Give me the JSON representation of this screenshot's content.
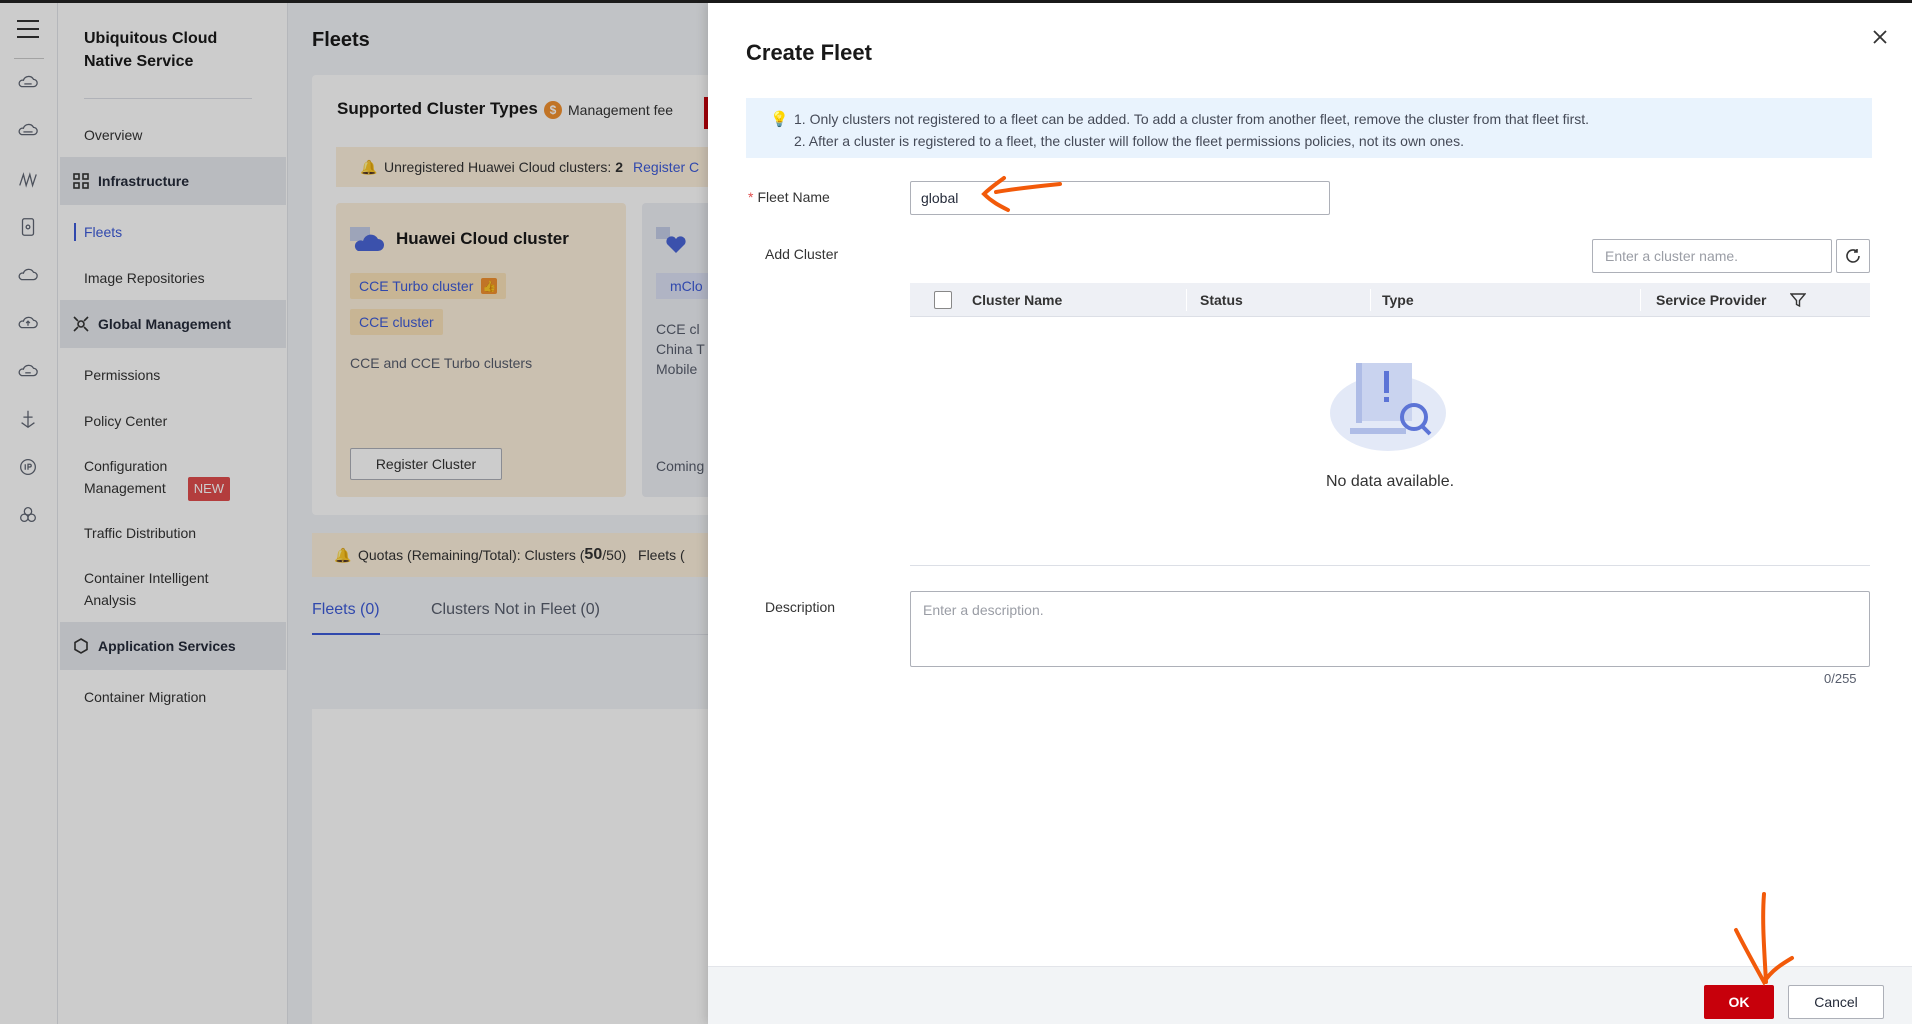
{
  "app": {
    "service_title": "Ubiquitous Cloud Native Service",
    "rail_icons": [
      "cloud-icon",
      "cloud-server-icon",
      "pipeline-icon",
      "container-icon",
      "cloud-outline-icon",
      "cloud-upload-icon",
      "cloud-sync-icon",
      "anchor-icon",
      "ip-icon",
      "cluster-icon"
    ]
  },
  "sidebar": {
    "overview": "Overview",
    "infrastructure": "Infrastructure",
    "fleets": "Fleets",
    "image_repositories": "Image Repositories",
    "global_management": "Global Management",
    "permissions": "Permissions",
    "policy_center": "Policy Center",
    "configuration_management_1": "Configuration",
    "configuration_management_2": "Management",
    "new_badge": "NEW",
    "traffic_distribution": "Traffic Distribution",
    "container_analysis_1": "Container Intelligent",
    "container_analysis_2": "Analysis",
    "application_services": "Application Services",
    "container_migration": "Container Migration"
  },
  "page": {
    "title": "Fleets",
    "supported_title": "Supported Cluster Types",
    "management_fee": "Management fee",
    "unregistered_label": "Unregistered Huawei Cloud clusters:",
    "unregistered_count": "2",
    "register_link": "Register C",
    "huawei_card": {
      "title": "Huawei Cloud cluster",
      "tag1": "CCE Turbo cluster",
      "tag2": "CCE cluster",
      "desc": "CCE and CCE Turbo clusters",
      "button": "Register Cluster"
    },
    "second_card": {
      "tag": "mClo",
      "desc_1": "CCE cl",
      "desc_2": "China T",
      "desc_3": "Mobile",
      "coming": "Coming"
    },
    "quota_prefix": "Quotas (Remaining/Total): Clusters (",
    "quota_clusters_remaining": "50",
    "quota_clusters_total": "/50)",
    "quota_fleets": "Fleets (",
    "tab_fleets": "Fleets (0)",
    "tab_not_in_fleet": "Clusters Not in Fleet (0)"
  },
  "drawer": {
    "title": "Create Fleet",
    "info_line1": "1. Only clusters not registered to a fleet can be added. To add a cluster from another fleet, remove the cluster from that fleet first.",
    "info_line2": "2. After a cluster is registered to a fleet, the cluster will follow the fleet permissions policies, not its own ones.",
    "fleet_name_label": "Fleet Name",
    "fleet_name_value": "global",
    "add_cluster_label": "Add Cluster",
    "search_placeholder": "Enter a cluster name.",
    "columns": [
      "Cluster Name",
      "Status",
      "Type",
      "Service Provider"
    ],
    "no_data": "No data available.",
    "description_label": "Description",
    "description_placeholder": "Enter a description.",
    "counter": "0/255",
    "ok": "OK",
    "cancel": "Cancel"
  },
  "colors": {
    "brand_red": "#c7000b",
    "link_blue": "#3d5bd9",
    "annotation_orange": "#f25a0a"
  }
}
